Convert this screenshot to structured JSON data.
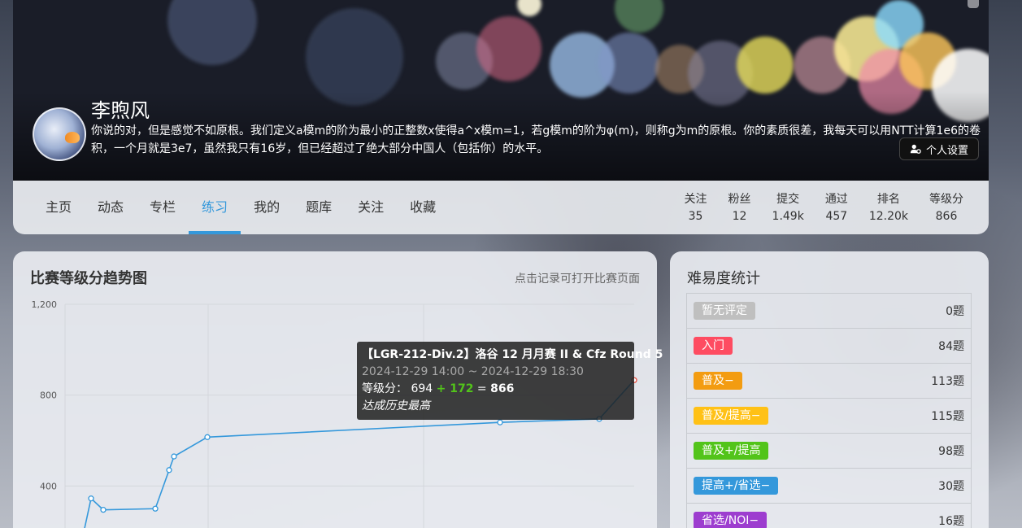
{
  "profile": {
    "username": "李煦风",
    "bio": "你说的对，但是感觉不如原根。我们定义a模m的阶为最小的正整数x使得a^x模m=1，若g模m的阶为φ(m)，则称g为m的原根。你的素质很差，我每天可以用NTT计算1e6的卷积，一个月就是3e7，虽然我只有16岁，但已经超过了绝大部分中国人（包括你）的水平。",
    "settings_label": "个人设置"
  },
  "nav": {
    "tabs": [
      "主页",
      "动态",
      "专栏",
      "练习",
      "我的",
      "题库",
      "关注",
      "收藏"
    ],
    "active_tab": "练习"
  },
  "stats": [
    {
      "label": "关注",
      "value": "35"
    },
    {
      "label": "粉丝",
      "value": "12"
    },
    {
      "label": "提交",
      "value": "1.49k"
    },
    {
      "label": "通过",
      "value": "457"
    },
    {
      "label": "排名",
      "value": "12.20k"
    },
    {
      "label": "等级分",
      "value": "866"
    }
  ],
  "rating_card": {
    "title": "比赛等级分趋势图",
    "hint": "点击记录可打开比赛页面"
  },
  "chart_data": {
    "type": "line",
    "yticks": [
      "1,200",
      "800",
      "400"
    ],
    "ylim": [
      0,
      1200
    ],
    "series": [
      {
        "values": [
          180,
          345,
          295,
          300,
          470,
          530,
          615,
          680,
          695,
          866
        ]
      }
    ],
    "line_color": "#3498db",
    "highlight_color": "#e74c3c",
    "grid": true
  },
  "tooltip": {
    "title": "【LGR-212-Div.2】洛谷 12 月月赛 II & Cfz Round 5",
    "time": "2024-12-29 14:00 ~ 2024-12-29 18:30",
    "rating_label": "等级分：",
    "old_rating": "694",
    "delta": "+ 172",
    "eq": "=",
    "new_rating": "866",
    "note": "达成历史最高"
  },
  "difficulty": {
    "title": "难易度统计",
    "rows": [
      {
        "label": "暂无评定",
        "count": "0题",
        "color": "#bfbfbf"
      },
      {
        "label": "入门",
        "count": "84题",
        "color": "#fe4c61"
      },
      {
        "label": "普及−",
        "count": "113题",
        "color": "#f39c11"
      },
      {
        "label": "普及/提高−",
        "count": "115题",
        "color": "#ffc116"
      },
      {
        "label": "普及+/提高",
        "count": "98题",
        "color": "#52c41a"
      },
      {
        "label": "提高+/省选−",
        "count": "30题",
        "color": "#3498db"
      },
      {
        "label": "省选/NOI−",
        "count": "16题",
        "color": "#9d3dcf"
      }
    ]
  }
}
